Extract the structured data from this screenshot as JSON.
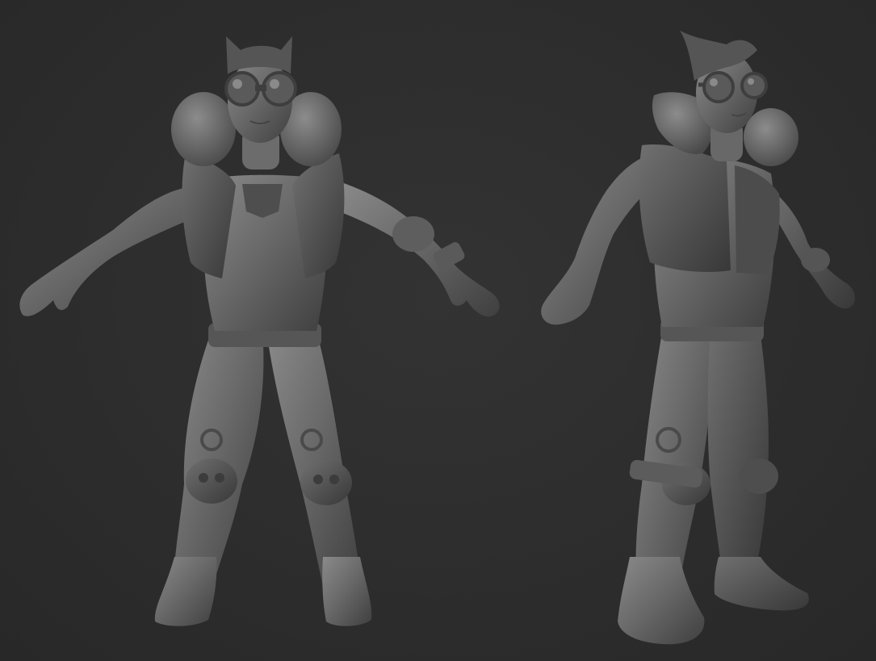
{
  "scene": {
    "background_color": "#2c2c2c",
    "material_color": "#6d6d6d",
    "views": [
      {
        "view": "front"
      },
      {
        "view": "three-quarter"
      }
    ]
  }
}
